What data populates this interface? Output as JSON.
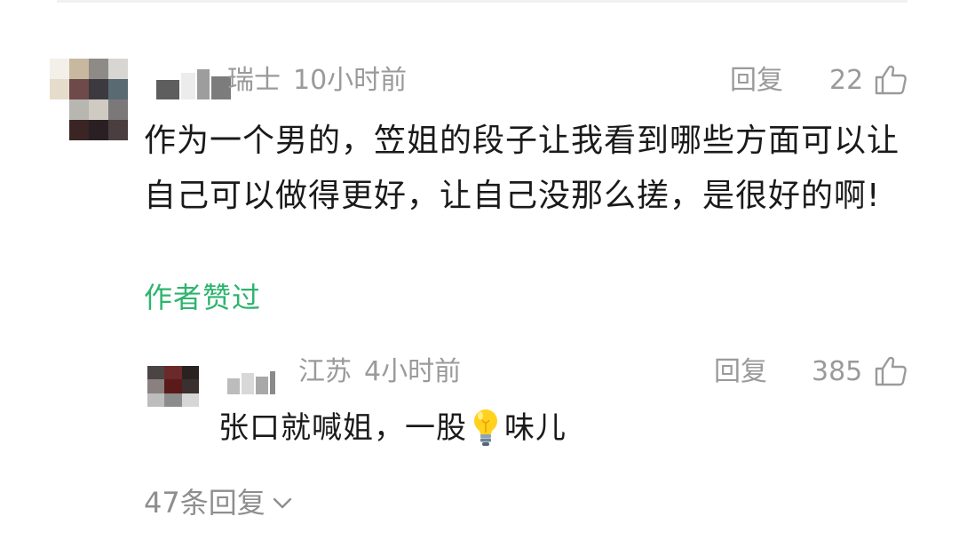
{
  "comment": {
    "location": "瑞士",
    "time": "10小时前",
    "reply_label": "回复",
    "like_count": "22",
    "text": "作为一个男的，笠姐的段子让我看到哪些方面可以让自己可以做得更好，让自己没那么搓，是很好的啊!",
    "author_liked_label": "作者赞过"
  },
  "reply": {
    "location": "江苏",
    "time": "4小时前",
    "reply_label": "回复",
    "like_count": "385",
    "text_before_emoji": "张口就喊姐，一股",
    "emoji": "light-bulb-icon",
    "text_after_emoji": "味儿"
  },
  "more_replies": {
    "label": "47条回复"
  },
  "icons": {
    "like": "thumbs-up-icon",
    "expand": "chevron-down-icon"
  },
  "colors": {
    "meta_gray": "#9a9a9a",
    "author_liked_green": "#2db46e",
    "body_text": "#1a1a1a"
  }
}
